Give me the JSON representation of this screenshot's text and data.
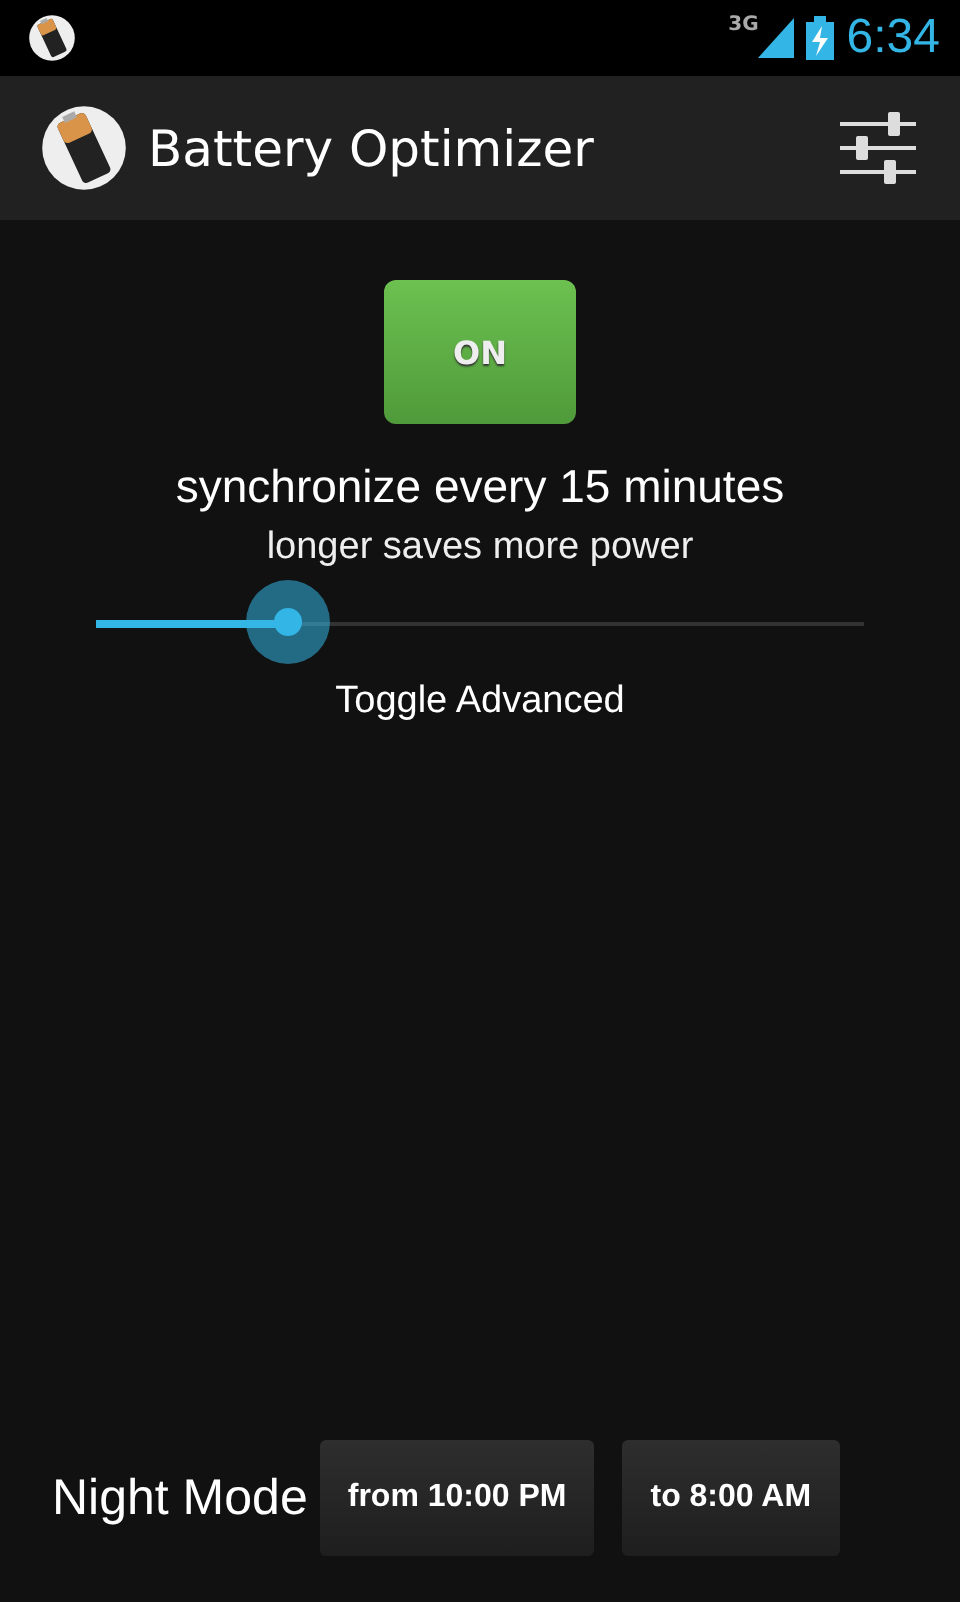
{
  "status_bar": {
    "network": "3G",
    "time": "6:34"
  },
  "app_bar": {
    "title": "Battery Optimizer"
  },
  "power_toggle": {
    "label": "ON",
    "on": true
  },
  "sync_text": "synchronize every 15 minutes",
  "sync_hint": "longer saves more power",
  "sync_slider": {
    "level": 0.25
  },
  "advanced_link": "Toggle Advanced",
  "night_mode": {
    "label": "Night Mode",
    "from": "from 10:00 PM",
    "to": "to 8:00 AM"
  }
}
